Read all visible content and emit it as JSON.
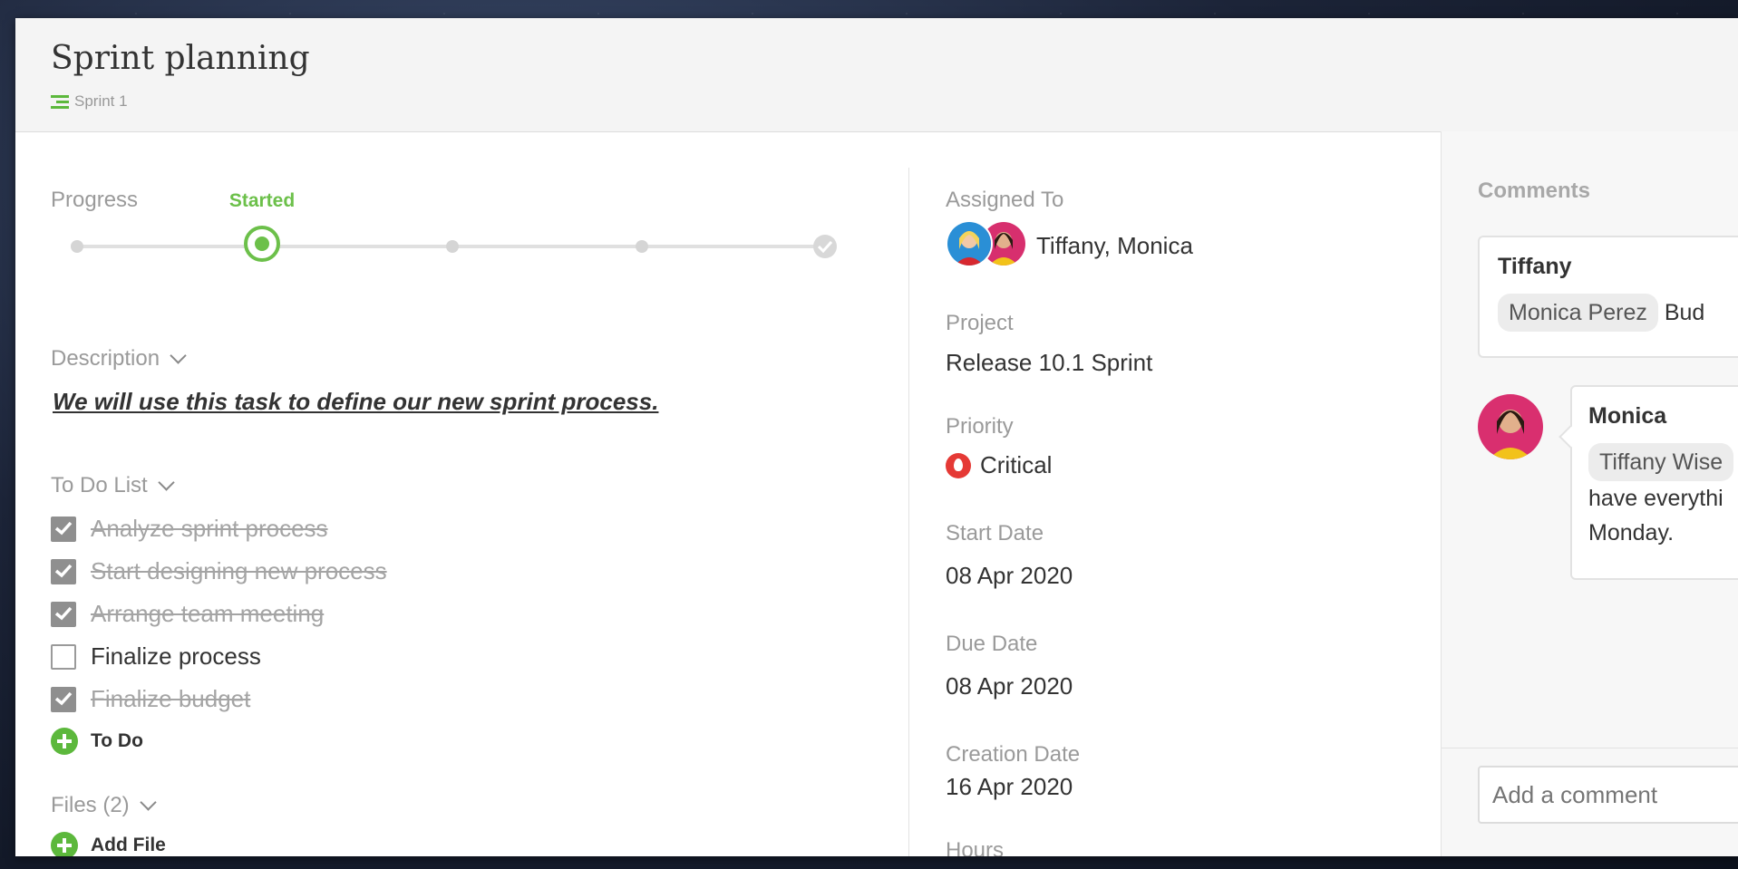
{
  "task": {
    "title": "Sprint planning",
    "sprint": "Sprint 1"
  },
  "progress": {
    "label": "Progress",
    "current_stage_label": "Started",
    "current_step": 2,
    "total_steps": 5
  },
  "description": {
    "label": "Description",
    "text": "We will use this task to define our new sprint process."
  },
  "todo": {
    "label": "To Do List",
    "items": [
      {
        "text": "Analyze sprint process",
        "done": true
      },
      {
        "text": "Start designing new process",
        "done": true
      },
      {
        "text": "Arrange team meeting",
        "done": true
      },
      {
        "text": "Finalize process",
        "done": false
      },
      {
        "text": "Finalize budget",
        "done": true
      }
    ],
    "add_label": "To Do"
  },
  "files": {
    "label": "Files (2)",
    "add_label": "Add File"
  },
  "details": {
    "assigned_label": "Assigned To",
    "assigned_value": "Tiffany, Monica",
    "project_label": "Project",
    "project_value": "Release 10.1 Sprint",
    "priority_label": "Priority",
    "priority_value": "Critical",
    "start_label": "Start Date",
    "start_value": "08 Apr 2020",
    "due_label": "Due Date",
    "due_value": "08 Apr 2020",
    "creation_label": "Creation Date",
    "creation_value": "16 Apr 2020",
    "hours_label": "Hours"
  },
  "comments": {
    "title": "Comments",
    "items": [
      {
        "author": "Tiffany",
        "mention": "Monica  Perez",
        "text": "Bud"
      },
      {
        "author": "Monica",
        "mention": "Tiffany Wise",
        "line2": "have everythi",
        "line3": "Monday."
      }
    ],
    "input_placeholder": "Add a comment"
  },
  "colors": {
    "accent_green": "#6cc04a",
    "priority_red": "#e53935"
  }
}
